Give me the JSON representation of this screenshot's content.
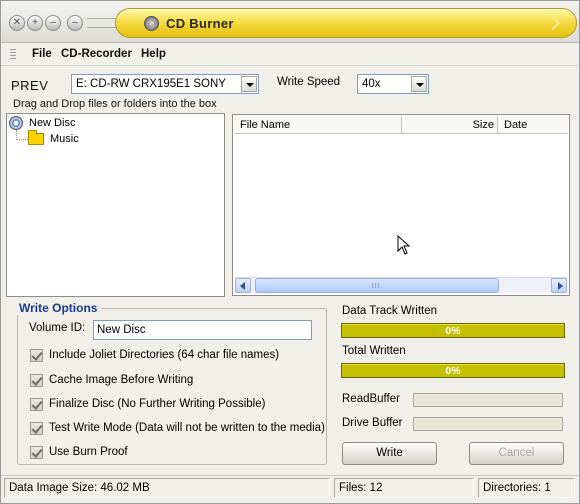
{
  "titlebar": {
    "title": "CD Burner",
    "buttons": [
      "✕",
      "+",
      "–",
      "–"
    ]
  },
  "menu": {
    "items": [
      {
        "label": "File"
      },
      {
        "label": "CD-Recorder"
      },
      {
        "label": "Help"
      }
    ]
  },
  "toolbar": {
    "prev_label": "PREV",
    "drive_selected": "E: CD-RW  CRX195E1  SONY",
    "write_speed_label": "Write Speed",
    "write_speed_selected": "40x",
    "drag_hint": "Drag and Drop files or folders into the box"
  },
  "tree": {
    "root": "New Disc",
    "children": [
      "Music"
    ]
  },
  "filelist": {
    "columns": [
      "File Name",
      "Size",
      "Date"
    ],
    "rows": []
  },
  "write_options": {
    "title": "Write Options",
    "volume_label": "Volume ID:",
    "volume_value": "New Disc",
    "checkboxes": [
      {
        "label": "Include Joliet Directories (64 char file names)",
        "checked": true
      },
      {
        "label": "Cache Image Before Writing",
        "checked": true
      },
      {
        "label": "Finalize Disc (No Further Writing Possible)",
        "checked": true
      },
      {
        "label": "Test Write Mode (Data will not be written to the media)",
        "checked": true
      },
      {
        "label": "Use Burn Proof",
        "checked": true
      }
    ]
  },
  "progress": {
    "data_track_label": "Data Track Written",
    "data_track_value": "0%",
    "total_label": "Total Written",
    "total_value": "0%",
    "read_buffer_label": "ReadBuffer",
    "drive_buffer_label": "Drive Buffer",
    "write_button": "Write",
    "cancel_button": "Cancel"
  },
  "status": {
    "data_image_size": "Data Image Size: 46.02 MB",
    "files": "Files: 12",
    "directories": "Directories: 1"
  },
  "colors": {
    "title_yellow": "#f2d637",
    "progress_olive": "#c4c000",
    "group_title_blue": "#1c3a8e"
  }
}
